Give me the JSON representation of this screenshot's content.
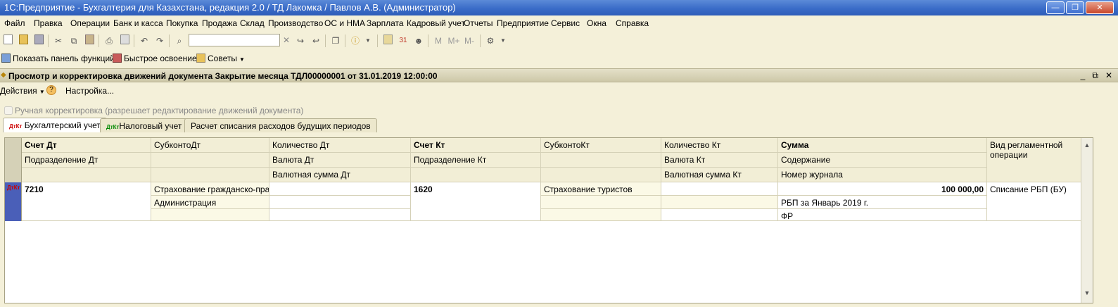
{
  "window": {
    "title": "1С:Предприятие - Бухгалтерия для Казахстана, редакция 2.0 / ТД Лакомка / Павлов А.В. (Администратор)",
    "buttons": [
      "—",
      "❐",
      "✕"
    ]
  },
  "menu": [
    "Файл",
    "Правка",
    "Операции",
    "Банк и касса",
    "Покупка",
    "Продажа",
    "Склад",
    "Производство",
    "ОС и НМА",
    "Зарплата",
    "Кадровый учет",
    "Отчеты",
    "Предприятие",
    "Сервис",
    "Окна",
    "Справка"
  ],
  "toolbar": {
    "search_value": "",
    "m_buttons": [
      "M",
      "M+",
      "M-"
    ]
  },
  "funcbar": {
    "show_panel": "Показать панель функций",
    "quick_learn": "Быстрое освоение",
    "tips": "Советы"
  },
  "document": {
    "title": "Просмотр и корректировка движений документа Закрытие месяца ТДЛ00000001 от 31.01.2019 12:00:00",
    "header_buttons": [
      "_",
      "⧉",
      "✕"
    ]
  },
  "actionbar": {
    "actions": "Действия",
    "help": "?",
    "settings": "Настройка..."
  },
  "manual_correction": {
    "label": "Ручная корректировка (разрешает редактирование движений документа)",
    "checked": false
  },
  "tabs": [
    {
      "label": "Бухгалтерский учет",
      "active": true
    },
    {
      "label": "Налоговый учет",
      "active": false
    },
    {
      "label": "Расчет списания расходов будущих периодов",
      "active": false
    }
  ],
  "grid": {
    "headers": {
      "row1": [
        "Счет Дт",
        "СубконтоДт",
        "Количество Дт",
        "Счет Кт",
        "СубконтоКт",
        "Количество Кт",
        "Сумма",
        "Вид регламентной операции"
      ],
      "row2": [
        "Подразделение Дт",
        "",
        "Валюта Дт",
        "Подразделение Кт",
        "",
        "Валюта Кт",
        "Содержание"
      ],
      "row3": [
        "",
        "",
        "Валютная сумма Дт",
        "",
        "",
        "Валютная сумма Кт",
        "Номер журнала"
      ]
    },
    "rows": [
      {
        "account_dt": "7210",
        "subconto_dt": "Страхование гражданско-пра...",
        "qty_dt": "",
        "account_kt": "1620",
        "subconto_kt": "Страхование туристов",
        "qty_kt": "",
        "amount": "100 000,00",
        "operation": "Списание РБП (БУ)",
        "subdivision_dt": "",
        "subconto_dt2": "Администрация",
        "currency_dt": "",
        "subdivision_kt": "",
        "currency_kt": "",
        "content": "РБП за Январь 2019 г.",
        "currency_sum_dt": "",
        "currency_sum_kt": "",
        "journal": "ФР"
      }
    ]
  }
}
